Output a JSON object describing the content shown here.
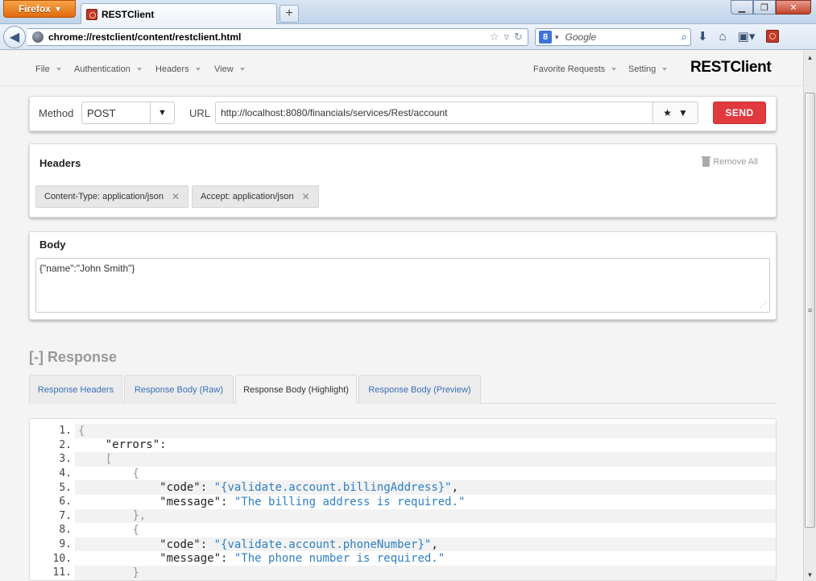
{
  "browser": {
    "menu_button": "Firefox",
    "tab_title": "RESTClient",
    "new_tab": "+",
    "url": "chrome://restclient/content/restclient.html",
    "search_placeholder": "Google",
    "search_engine_letter": "8"
  },
  "app": {
    "brand": "RESTClient",
    "menu": [
      "File",
      "Authentication",
      "Headers",
      "View"
    ],
    "menu_right": [
      "Favorite Requests",
      "Setting"
    ]
  },
  "request": {
    "method_label": "Method",
    "method": "POST",
    "url_label": "URL",
    "url": "http://localhost:8080/financials/services/Rest/account",
    "send_label": "SEND"
  },
  "headers": {
    "title": "Headers",
    "remove_all": "Remove All",
    "items": [
      "Content-Type: application/json",
      "Accept: application/json"
    ]
  },
  "body": {
    "title": "Body",
    "text": "{\"name\":\"John Smith\"}"
  },
  "response": {
    "title": "[-] Response",
    "tabs": [
      "Response Headers",
      "Response Body (Raw)",
      "Response Body (Highlight)",
      "Response Body (Preview)"
    ],
    "active_tab": "Response Body (Highlight)",
    "lines": [
      {
        "n": "1.",
        "indent": "",
        "parts": [
          [
            "punc",
            "{"
          ]
        ]
      },
      {
        "n": "2.",
        "indent": "    ",
        "parts": [
          [
            "key",
            "\"errors\""
          ],
          [
            "key",
            ":"
          ]
        ]
      },
      {
        "n": "3.",
        "indent": "    ",
        "parts": [
          [
            "punc",
            "["
          ]
        ]
      },
      {
        "n": "4.",
        "indent": "        ",
        "parts": [
          [
            "punc",
            "{"
          ]
        ]
      },
      {
        "n": "5.",
        "indent": "            ",
        "parts": [
          [
            "key",
            "\"code\""
          ],
          [
            "key",
            ": "
          ],
          [
            "str",
            "\"{validate.account.billingAddress}\""
          ],
          [
            "key",
            ","
          ]
        ]
      },
      {
        "n": "6.",
        "indent": "            ",
        "parts": [
          [
            "key",
            "\"message\""
          ],
          [
            "key",
            ": "
          ],
          [
            "str",
            "\"The billing address is required.\""
          ]
        ]
      },
      {
        "n": "7.",
        "indent": "        ",
        "parts": [
          [
            "punc",
            "},"
          ]
        ]
      },
      {
        "n": "8.",
        "indent": "        ",
        "parts": [
          [
            "punc",
            "{"
          ]
        ]
      },
      {
        "n": "9.",
        "indent": "            ",
        "parts": [
          [
            "key",
            "\"code\""
          ],
          [
            "key",
            ": "
          ],
          [
            "str",
            "\"{validate.account.phoneNumber}\""
          ],
          [
            "key",
            ","
          ]
        ]
      },
      {
        "n": "10.",
        "indent": "            ",
        "parts": [
          [
            "key",
            "\"message\""
          ],
          [
            "key",
            ": "
          ],
          [
            "str",
            "\"The phone number is required.\""
          ]
        ]
      },
      {
        "n": "11.",
        "indent": "        ",
        "parts": [
          [
            "punc",
            "}"
          ]
        ]
      }
    ]
  },
  "colors": {
    "send": "#e0393e",
    "link": "#3a6fb8",
    "string": "#2c7fc5",
    "firefox": "#e26a0d"
  }
}
